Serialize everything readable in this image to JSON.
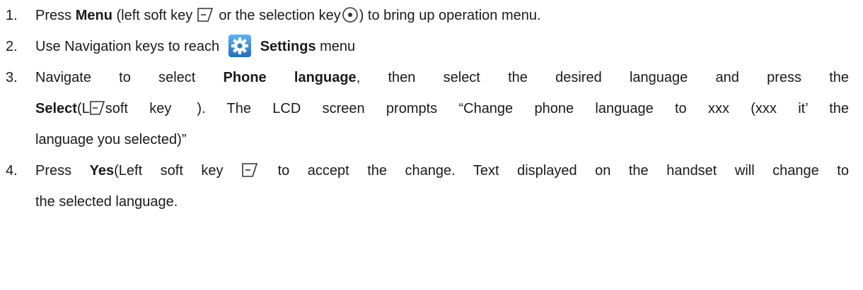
{
  "steps": [
    {
      "number": "1.",
      "t1": "Press ",
      "b1": "Menu",
      "t2": " (left soft key ",
      "t3": " or the selection key",
      "t4": ") to bring up operation menu."
    },
    {
      "number": "2.",
      "t1": "Use Navigation keys to reach ",
      "b1": "Settings",
      "t2": " menu"
    },
    {
      "number": "3.",
      "line1_t1": "Navigate to select ",
      "line1_b1": "Phone language",
      "line1_t2": ", then select the desired language and press the",
      "line2_b1": "Select",
      "line2_t1": "(L",
      "line2_t2": "soft key",
      "line2_t3": "). The LCD screen prompts “Change phone language to xxx (xxx it’ the",
      "line3": "language you selected)”"
    },
    {
      "number": "4.",
      "line1_t1": "Press ",
      "line1_b1": "Yes",
      "line1_t2": "(Left soft key ",
      "line1_t3": " to accept the change. Text displayed on the handset will change to",
      "line2": "the selected language."
    }
  ],
  "icons": {
    "soft_key": "left-soft-key-icon",
    "selection_key": "selection-key-icon",
    "settings": "settings-gear-icon"
  },
  "colors": {
    "text": "#1a1a1a",
    "settings_icon_bg": "#3a8fd9"
  }
}
